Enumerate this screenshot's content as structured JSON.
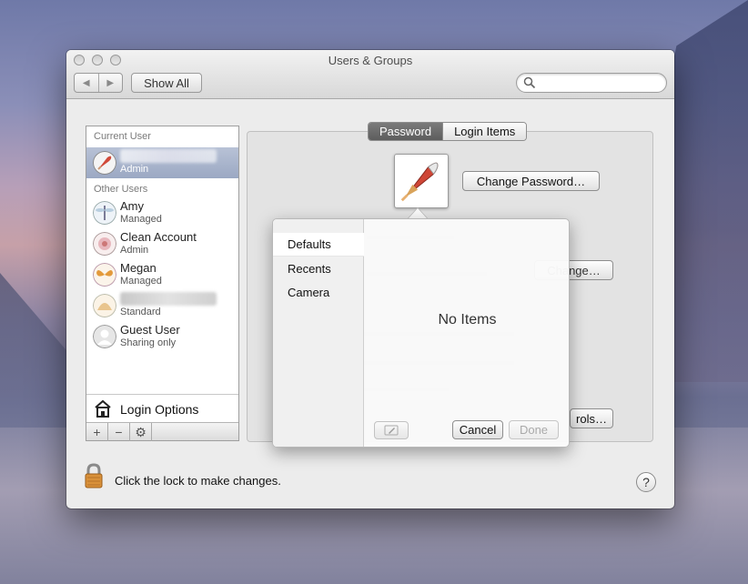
{
  "window": {
    "title": "Users & Groups",
    "show_all": "Show All",
    "search": {
      "placeholder": ""
    }
  },
  "sidebar": {
    "current_user_header": "Current User",
    "current_user": {
      "role": "Admin"
    },
    "other_users_header": "Other Users",
    "users": [
      {
        "name": "Amy",
        "role": "Managed",
        "icon": "dragonfly-avatar"
      },
      {
        "name": "Clean Account",
        "role": "Admin",
        "icon": "flower-avatar"
      },
      {
        "name": "Megan",
        "role": "Managed",
        "icon": "butterfly-avatar"
      },
      {
        "name": "",
        "role": "Standard",
        "icon": "shell-avatar"
      },
      {
        "name": "Guest User",
        "role": "Sharing only",
        "icon": "person-avatar"
      }
    ],
    "login_options": "Login Options",
    "tools": {
      "add": "+",
      "remove": "−",
      "gear": "⚙"
    }
  },
  "pane": {
    "tabs": [
      "Password",
      "Login Items"
    ],
    "active_tab": "Password",
    "change_password": "Change Password…",
    "change": "Change…",
    "controls": "rols…"
  },
  "popover": {
    "items": [
      "Defaults",
      "Recents",
      "Camera"
    ],
    "selected": "Defaults",
    "empty_text": "No Items",
    "cancel": "Cancel",
    "done": "Done"
  },
  "footer": {
    "lock_text": "Click the lock to make changes.",
    "help": "?"
  }
}
